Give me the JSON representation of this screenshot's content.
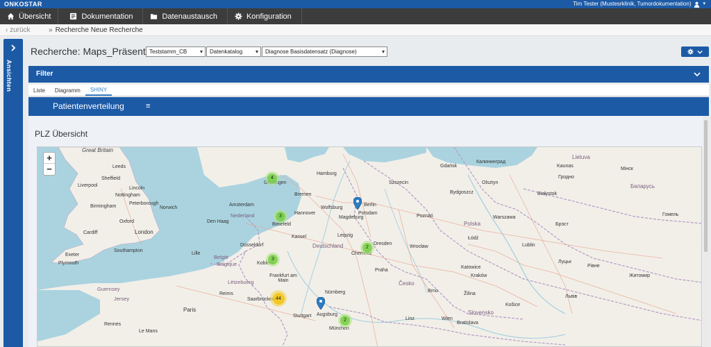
{
  "brand": {
    "logo": "ONKOSTAR",
    "user": "Tim Tester  (Mustesrklinik, Tumordokumentation)"
  },
  "nav": [
    {
      "label": "Übersicht",
      "icon": "home-icon"
    },
    {
      "label": "Dokumentation",
      "icon": "document-icon"
    },
    {
      "label": "Datenaustausch",
      "icon": "folder-icon"
    },
    {
      "label": "Konfiguration",
      "icon": "gear-icon"
    }
  ],
  "breadcrumb": {
    "back": "‹ zurück",
    "sep": "»",
    "current": "Recherche Neue Recherche"
  },
  "sidetab": {
    "label": "Ansichten"
  },
  "page": {
    "title": "Recherche: Maps_Präsentation",
    "selects": [
      {
        "value": "Teststamm_CB"
      },
      {
        "value": "Datenkatalog"
      },
      {
        "value": "Diagnose Basisdatensatz (Diagnose)"
      }
    ]
  },
  "filter": {
    "label": "Filter"
  },
  "tabs": [
    "Liste",
    "Diagramm",
    "SHINY"
  ],
  "tabs_active": "SHINY",
  "shiny": {
    "title": "Patientenverteilung",
    "burger": "≡"
  },
  "section": {
    "title": "PLZ Übersicht"
  },
  "map": {
    "zoom_in": "+",
    "zoom_out": "−",
    "clusters": [
      {
        "count": "4",
        "size": "small"
      },
      {
        "count": "3",
        "size": "small"
      },
      {
        "count": "3",
        "size": "small"
      },
      {
        "count": "2",
        "size": "small"
      },
      {
        "count": "44",
        "size": "medium"
      },
      {
        "count": "2",
        "size": "small"
      }
    ],
    "places": {
      "great_britain": "Great Britain",
      "leeds": "Leeds",
      "sheffield": "Sheffield",
      "liverpool": "Liverpool",
      "lincoln": "Lincoln",
      "nottingham": "Nottingham",
      "birmingham": "Birmingham",
      "peterborough": "Peterborough",
      "norwich": "Norwich",
      "oxford": "Oxford",
      "london": "London",
      "cardiff": "Cardiff",
      "southampton": "Southampton",
      "plymouth": "Plymouth",
      "exeter": "Exeter",
      "guernsey": "Guernsey",
      "jersey": "Jersey",
      "rennes": "Rennes",
      "le_mans": "Le Mans",
      "paris": "Paris",
      "reims": "Reims",
      "lille": "Lille",
      "belgie": "België",
      "belgique": "Belgique",
      "nederland": "Nederland",
      "den_haag": "Den Haag",
      "amsterdam": "Amsterdam",
      "groningen": "Groningen",
      "bremen": "Bremen",
      "hamburg": "Hamburg",
      "hannover": "Hannover",
      "bielefeld": "Bielefeld",
      "dusseldorf": "Düsseldorf",
      "koblenz": "Koblenz",
      "kassel": "Kassel",
      "wolfsburg": "Wolfsburg",
      "magdeburg": "Magdeburg",
      "potsdam": "Potsdam",
      "berlin": "Berlin",
      "leipzig": "Leipzig",
      "chemnitz": "Chemnitz",
      "dresden": "Dresden",
      "deutschland": "Deutschland",
      "frankfurt": "Frankfurt am Main",
      "nurnberg": "Nürnberg",
      "stuttgart": "Stuttgart",
      "munchen": "München",
      "augsburg": "Augsburg",
      "saarbrucken": "Saarbrücken",
      "luxembourg": "Lëtzebuerg",
      "praha": "Praha",
      "cesko": "Česko",
      "brno": "Brno",
      "wien": "Wien",
      "bratislava": "Bratislava",
      "linz": "Linz",
      "polska": "Polska",
      "warszawa": "Warszawa",
      "lodz": "Łódź",
      "krakow": "Kraków",
      "katowice": "Katowice",
      "wroclaw": "Wrocław",
      "poznan": "Poznań",
      "szczecin": "Szczecin",
      "gdansk": "Gdańsk",
      "kaliningrad": "Калининград",
      "lithuania": "Lietuva",
      "kaunas": "Kaunas",
      "grodno": "Гродно",
      "belarus": "Беларусь",
      "minsk": "Мінск",
      "brest": "Брэст",
      "gomel": "Гомель",
      "rivne": "Рівне",
      "lutsk": "Луцьк",
      "zhytomyr": "Житомир",
      "lviv": "Львів",
      "kosice": "Košice",
      "slovensko": "Slovensko",
      "zilina": "Žilina",
      "lublin": "Lublin",
      "bydgoszcz": "Bydgoszcz",
      "olsztyn": "Olsztyn",
      "bialystok": "Białystok"
    }
  }
}
